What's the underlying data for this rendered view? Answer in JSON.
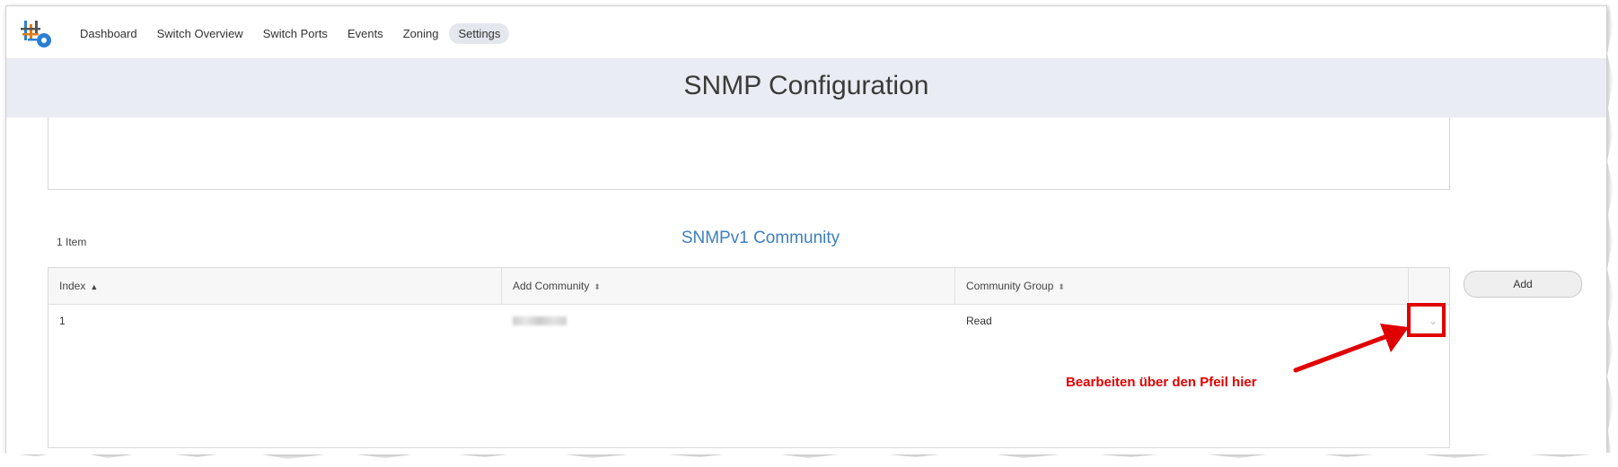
{
  "nav": {
    "items": [
      {
        "label": "Dashboard",
        "active": false
      },
      {
        "label": "Switch Overview",
        "active": false
      },
      {
        "label": "Switch Ports",
        "active": false
      },
      {
        "label": "Events",
        "active": false
      },
      {
        "label": "Zoning",
        "active": false
      },
      {
        "label": "Settings",
        "active": true
      }
    ]
  },
  "page": {
    "title": "SNMP Configuration"
  },
  "section": {
    "item_count": "1 Item",
    "title": "SNMPv1 Community",
    "add_label": "Add"
  },
  "table": {
    "columns": [
      {
        "label": "Index",
        "sort": "asc"
      },
      {
        "label": "Add Community",
        "sort": "none"
      },
      {
        "label": "Community Group",
        "sort": "none"
      }
    ],
    "rows": [
      {
        "index": "1",
        "community": "[blurred]",
        "group": "Read"
      }
    ]
  },
  "annotation": {
    "text": "Bearbeiten über den Pfeil hier",
    "color": "#e00000"
  },
  "colors": {
    "accent": "#3d7fc1",
    "title_band": "#e9ecf2",
    "annotation": "#e00000"
  }
}
